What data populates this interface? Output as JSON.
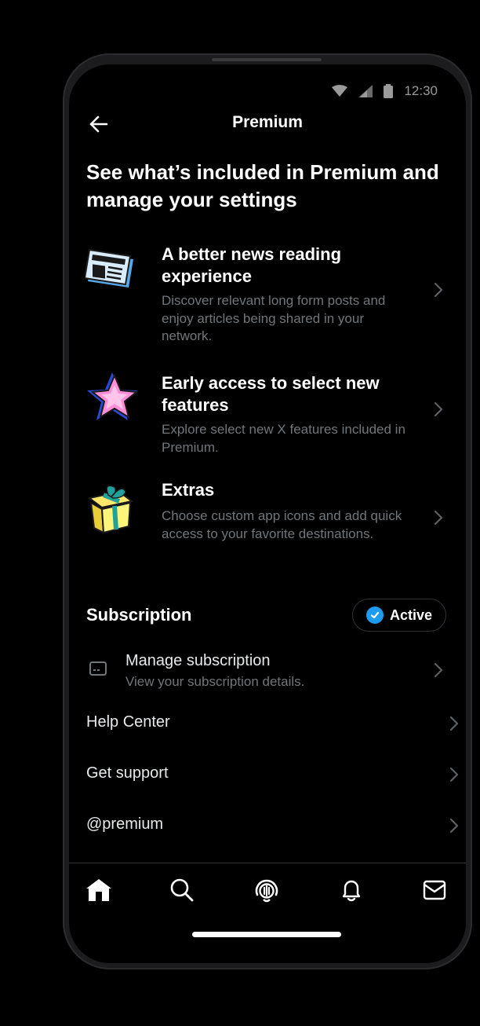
{
  "status_bar": {
    "time": "12:30"
  },
  "header": {
    "title": "Premium"
  },
  "headline": "See what’s included in Premium and manage your settings",
  "features": [
    {
      "title": "A better news reading experience",
      "description": "Discover relevant long form posts and enjoy articles being shared in your network.",
      "icon": "newspaper-icon"
    },
    {
      "title": "Early access to select new features",
      "description": "Explore select new X features included in Premium.",
      "icon": "star-icon"
    },
    {
      "title": "Extras",
      "description": "Choose custom app icons and add quick access to your favorite destinations.",
      "icon": "gift-icon"
    }
  ],
  "subscription": {
    "heading": "Subscription",
    "status": "Active",
    "manage_title": "Manage subscription",
    "manage_subtitle": "View your subscription details."
  },
  "links": [
    "Help Center",
    "Get support",
    "@premium"
  ],
  "nav": [
    "home-icon",
    "search-icon",
    "spaces-icon",
    "notifications-icon",
    "messages-icon"
  ],
  "colors": {
    "accent": "#1d9bf0",
    "background": "#000000",
    "secondary_text": "#71767b"
  }
}
